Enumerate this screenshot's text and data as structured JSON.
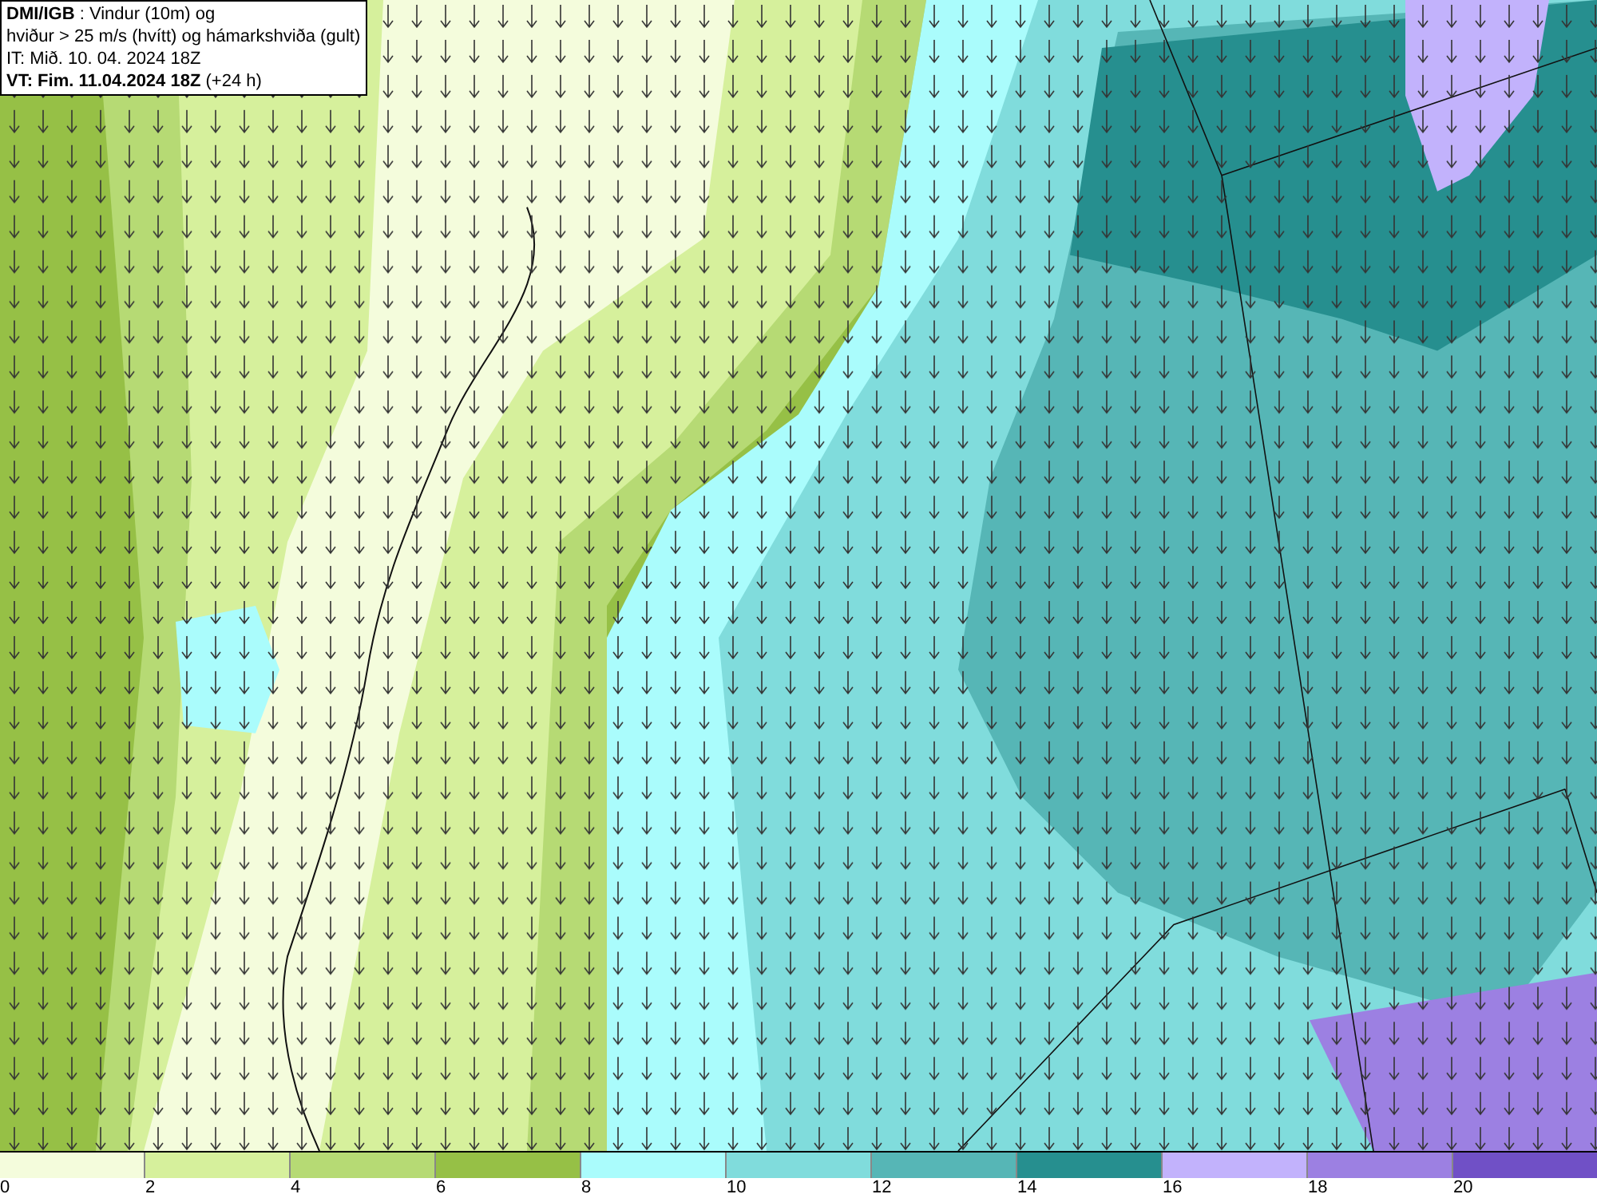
{
  "header": {
    "lines": [
      "**DMI/IGB** : Vindur (10m) og",
      "hviður > 25 m/s (hvítt) og hámarkshviða (gult)",
      "IT: Mið. 10. 04. 2024 18Z",
      "**VT: Fim. 11.04.2024 18Z** (+24 h)"
    ]
  },
  "legend": {
    "swatches": [
      {
        "color": "#f4fcdc"
      },
      {
        "color": "#d6f09c"
      },
      {
        "color": "#b6da74"
      },
      {
        "color": "#96c046"
      },
      {
        "color": "#aafcfc"
      },
      {
        "color": "#80dcdc"
      },
      {
        "color": "#56b6b6"
      },
      {
        "color": "#268f8f"
      },
      {
        "color": "#c2b2fc"
      },
      {
        "color": "#9c80e2"
      },
      {
        "color": "#7050c6"
      }
    ],
    "ticks": [
      "0",
      "2",
      "4",
      "6",
      "8",
      "10",
      "12",
      "14",
      "16",
      "18",
      "20"
    ]
  }
}
